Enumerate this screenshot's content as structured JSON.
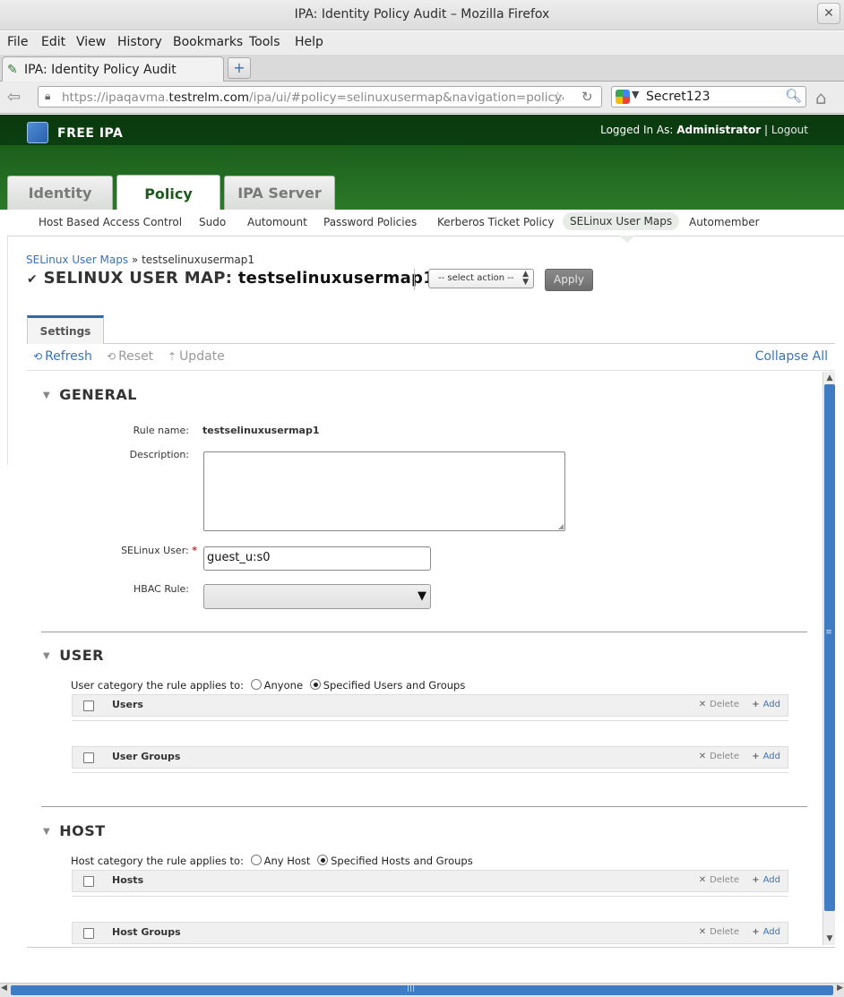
{
  "window": {
    "title": "IPA: Identity Policy Audit – Mozilla Firefox"
  },
  "menubar": [
    "File",
    "Edit",
    "View",
    "History",
    "Bookmarks",
    "Tools",
    "Help"
  ],
  "browser": {
    "tab_title": "IPA: Identity Policy Audit",
    "url_prefix": "https://ipaqavma.",
    "url_domain": "testrelm.com",
    "url_suffix": "/ipa/ui/#policy=selinuxusermap&navigation=policy&s",
    "search_value": "Secret123"
  },
  "header": {
    "logo_text": "FREE IPA",
    "logged_in_label": "Logged In As:",
    "user": "Administrator",
    "separator": "|",
    "logout": "Logout"
  },
  "main_tabs": [
    {
      "label": "Identity",
      "active": false
    },
    {
      "label": "Policy",
      "active": true
    },
    {
      "label": "IPA Server",
      "active": false
    }
  ],
  "sub_tabs": [
    {
      "label": "Host Based Access Control"
    },
    {
      "label": "Sudo"
    },
    {
      "label": "Automount"
    },
    {
      "label": "Password Policies"
    },
    {
      "label": "Kerberos Ticket Policy"
    },
    {
      "label": "SELinux User Maps",
      "active": true
    },
    {
      "label": "Automember"
    }
  ],
  "breadcrumb": {
    "parent": "SELinux User Maps",
    "sep": "»",
    "current": "testselinuxusermap1"
  },
  "page": {
    "title_prefix": "SELINUX USER MAP:",
    "title_name": "testselinuxusermap1",
    "action_select": "-- select action --",
    "apply": "Apply"
  },
  "settings_tab": "Settings",
  "toolbar": {
    "refresh": "Refresh",
    "reset": "Reset",
    "update": "Update",
    "collapse_all": "Collapse All"
  },
  "general": {
    "title": "GENERAL",
    "rule_name_label": "Rule name:",
    "rule_name_value": "testselinuxusermap1",
    "description_label": "Description:",
    "description_value": "",
    "selinux_user_label": "SELinux User:",
    "required_mark": "*",
    "selinux_user_value": "guest_u:s0",
    "hbac_rule_label": "HBAC Rule:"
  },
  "user": {
    "title": "USER",
    "category_label": "User category the rule applies to:",
    "opt_anyone": "Anyone",
    "opt_specified": "Specified Users and Groups",
    "table1": "Users",
    "table2": "User Groups"
  },
  "host": {
    "title": "HOST",
    "category_label": "Host category the rule applies to:",
    "opt_any": "Any Host",
    "opt_specified": "Specified Hosts and Groups",
    "table1": "Hosts",
    "table2": "Host Groups"
  },
  "table_actions": {
    "delete": "Delete",
    "add": "Add"
  },
  "colors": {
    "accent_blue": "#3a73b6",
    "header_green": "#1b5e1c",
    "policy_green": "#1d5a1d",
    "required_red": "#d22222"
  }
}
